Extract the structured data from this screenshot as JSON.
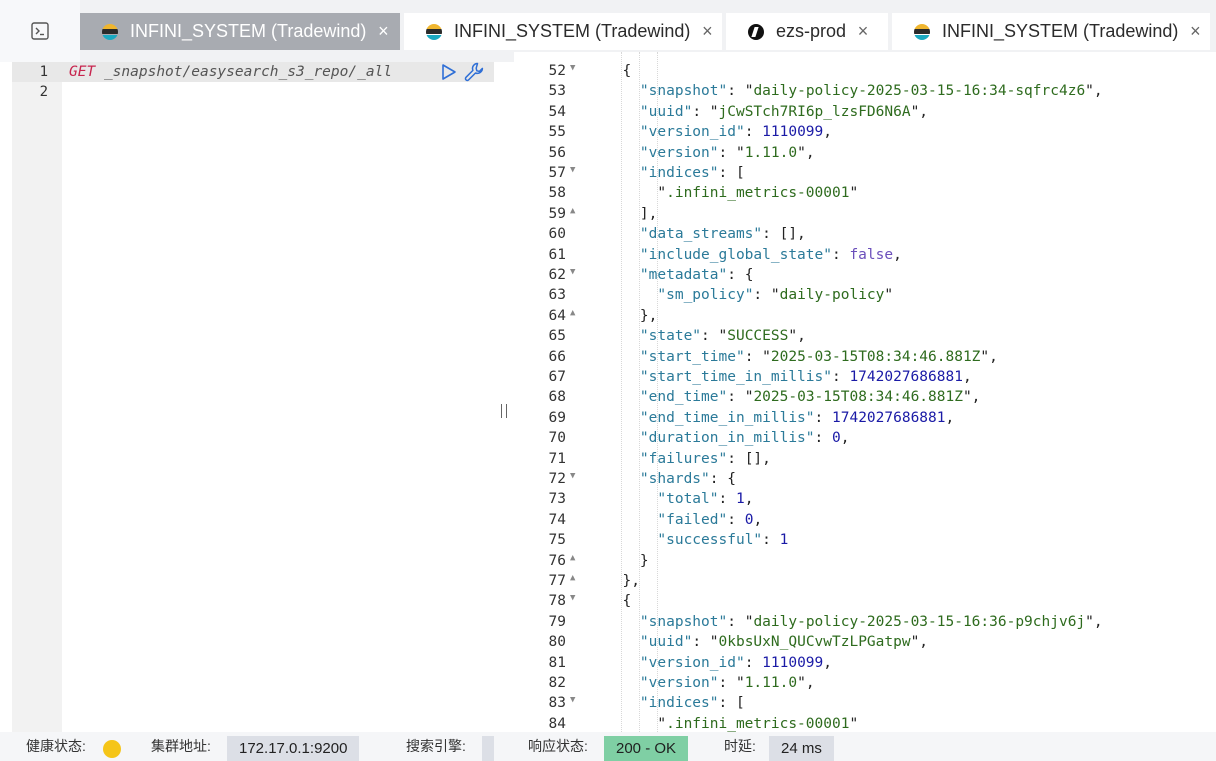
{
  "tabs": [
    {
      "label": "INFINI_SYSTEM (Tradewind)",
      "active": true,
      "icon": "easysearch-logo-icon"
    },
    {
      "label": "INFINI_SYSTEM (Tradewind)",
      "active": false,
      "icon": "easysearch-logo-icon"
    },
    {
      "label": "ezs-prod",
      "active": false,
      "icon": "ezs-logo-icon"
    },
    {
      "label": "INFINI_SYSTEM (Tradewind)",
      "active": false,
      "icon": "easysearch-logo-icon"
    }
  ],
  "close_glyph": "×",
  "editor": {
    "line_numbers": [
      "1",
      "2"
    ],
    "method": "GET",
    "path": "_snapshot/easysearch_s3_repo/_all"
  },
  "output": {
    "line_numbers": [
      "52",
      "53",
      "54",
      "55",
      "56",
      "57",
      "58",
      "59",
      "60",
      "61",
      "62",
      "63",
      "64",
      "65",
      "66",
      "67",
      "68",
      "69",
      "70",
      "71",
      "72",
      "73",
      "74",
      "75",
      "76",
      "77",
      "78",
      "79",
      "80",
      "81",
      "82",
      "83",
      "84"
    ],
    "snapshot_1": {
      "snapshot": "daily-policy-2025-03-15-16:34-sqfrc4z6",
      "uuid": "jCwSTch7RI6p_lzsFD6N6A",
      "version_id": "1110099",
      "version": "1.11.0",
      "indices": [
        ".infini_metrics-00001"
      ],
      "include_global_state": "false",
      "sm_policy": "daily-policy",
      "state": "SUCCESS",
      "start_time": "2025-03-15T08:34:46.881Z",
      "start_time_in_millis": "1742027686881",
      "end_time": "2025-03-15T08:34:46.881Z",
      "end_time_in_millis": "1742027686881",
      "duration_in_millis": "0",
      "shards_total": "1",
      "shards_failed": "0",
      "shards_successful": "1"
    },
    "snapshot_2": {
      "snapshot": "daily-policy-2025-03-15-16:36-p9chjv6j",
      "uuid": "0kbsUxN_QUCvwTzLPGatpw",
      "version_id": "1110099",
      "version": "1.11.0",
      "indices": [
        ".infini_metrics-00001"
      ]
    }
  },
  "status": {
    "health_label": "健康状态:",
    "health_color": "#f5c518",
    "cluster_label": "集群地址:",
    "cluster_value": "172.17.0.1:9200",
    "engine_label": "搜索引擎:",
    "response_label": "响应状态:",
    "response_value": "200 - OK",
    "response_color": "#7fcfa4",
    "latency_label": "时延:",
    "latency_value": "24 ms"
  }
}
